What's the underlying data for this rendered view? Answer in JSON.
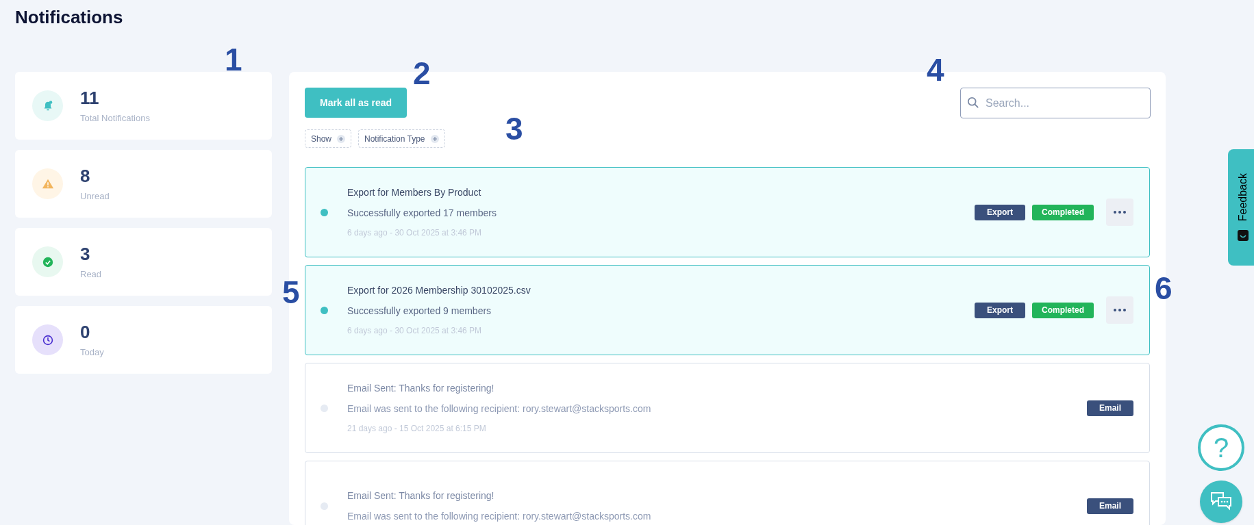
{
  "page_title": "Notifications",
  "stats": [
    {
      "kind": "total",
      "value": "11",
      "label": "Total Notifications"
    },
    {
      "kind": "unread",
      "value": "8",
      "label": "Unread"
    },
    {
      "kind": "read",
      "value": "3",
      "label": "Read"
    },
    {
      "kind": "today",
      "value": "0",
      "label": "Today"
    }
  ],
  "mark_all_button": "Mark all as read",
  "filters": [
    {
      "label": "Show"
    },
    {
      "label": "Notification Type"
    }
  ],
  "search": {
    "placeholder": "Search..."
  },
  "notifications": [
    {
      "title": "Export for Members By Product",
      "message": "Successfully exported 17 members",
      "time": "6 days ago - 30 Oct 2025 at 3:46 PM",
      "unread": true,
      "type_tag": "Export",
      "status_tag": "Completed",
      "has_menu": true
    },
    {
      "title": "Export for 2026 Membership 30102025.csv",
      "message": "Successfully exported 9 members",
      "time": "6 days ago - 30 Oct 2025 at 3:46 PM",
      "unread": true,
      "type_tag": "Export",
      "status_tag": "Completed",
      "has_menu": true
    },
    {
      "title": "Email Sent: Thanks for registering!",
      "message": "Email was sent to the following recipient: rory.stewart@stacksports.com",
      "time": "21 days ago - 15 Oct 2025 at 6:15 PM",
      "unread": false,
      "type_tag": "Email",
      "has_menu": false
    },
    {
      "title": "Email Sent: Thanks for registering!",
      "message": "Email was sent to the following recipient: rory.stewart@stacksports.com",
      "unread": false,
      "type_tag": "Email",
      "has_menu": false
    }
  ],
  "feedback_tab": "Feedback",
  "help_button": "?",
  "callouts": [
    {
      "number": "1"
    },
    {
      "number": "2"
    },
    {
      "number": "3"
    },
    {
      "number": "4"
    },
    {
      "number": "5"
    },
    {
      "number": "6"
    }
  ]
}
